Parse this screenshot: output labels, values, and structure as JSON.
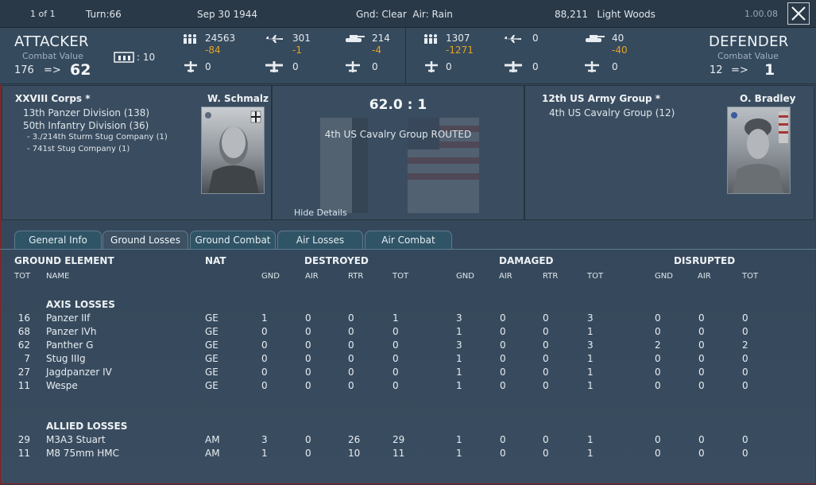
{
  "topbar": {
    "page": "1 of 1",
    "turn": "Turn:66",
    "date": "Sep 30 1944",
    "weather": "Gnd: Clear  Air: Rain",
    "location": "88,211   Light Woods",
    "version": "1.00.08"
  },
  "attacker": {
    "title": "ATTACKER",
    "cv_label": "Combat Value",
    "cv_from": "176",
    "cv_arrow": "=>",
    "cv_to": "62",
    "fort_value": ": 10",
    "men": "24563",
    "men_loss": "-84",
    "air": "301",
    "air_loss": "-1",
    "tanks": "214",
    "tanks_loss": "-4",
    "row2_a": "0",
    "row2_b": "0",
    "row2_c": "0"
  },
  "defender": {
    "title": "DEFENDER",
    "cv_label": "Combat Value",
    "cv_from": "12",
    "cv_arrow": "=>",
    "cv_to": "1",
    "men": "1307",
    "men_loss": "-1271",
    "air": "0",
    "tanks": "40",
    "tanks_loss": "-40",
    "row2_a": "0",
    "row2_b": "0",
    "row2_c": "0"
  },
  "attacker_panel": {
    "corps": "XXVIII Corps *",
    "leader": "W. Schmalz",
    "units": [
      "13th Panzer Division (138)",
      "50th Infantry Division (36)"
    ],
    "subunits": [
      "- 3./214th Sturm Stug Company (1)",
      "- 741st Stug Company (1)"
    ]
  },
  "center_panel": {
    "odds": "62.0 : 1",
    "result": "4th US Cavalry Group ROUTED",
    "hide_details": "Hide Details"
  },
  "defender_panel": {
    "corps": "12th US Army Group *",
    "leader": "O. Bradley",
    "units": [
      "4th US Cavalry Group (12)"
    ]
  },
  "tabs": [
    "General Info",
    "Ground Losses",
    "Ground Combat",
    "Air Losses",
    "Air Combat"
  ],
  "active_tab": "Ground Losses",
  "table": {
    "headers": {
      "element": "GROUND ELEMENT",
      "nat": "NAT",
      "destroyed": "DESTROYED",
      "damaged": "DAMAGED",
      "disrupted": "DISRUPTED"
    },
    "subheaders": {
      "tot": "TOT",
      "name": "NAME",
      "d_gnd": "GND",
      "d_air": "AIR",
      "d_rtr": "RTR",
      "d_tot": "TOT",
      "m_gnd": "GND",
      "m_air": "AIR",
      "m_rtr": "RTR",
      "m_tot": "TOT",
      "r_gnd": "GND",
      "r_air": "AIR",
      "r_tot": "TOT"
    },
    "axis_title": "AXIS LOSSES",
    "axis_rows": [
      [
        "16",
        "Panzer IIf",
        "GE",
        "1",
        "0",
        "0",
        "1",
        "3",
        "0",
        "0",
        "3",
        "0",
        "0",
        "0"
      ],
      [
        "68",
        "Panzer IVh",
        "GE",
        "0",
        "0",
        "0",
        "0",
        "1",
        "0",
        "0",
        "1",
        "0",
        "0",
        "0"
      ],
      [
        "62",
        "Panther G",
        "GE",
        "0",
        "0",
        "0",
        "0",
        "3",
        "0",
        "0",
        "3",
        "2",
        "0",
        "2"
      ],
      [
        "7",
        "Stug IIIg",
        "GE",
        "0",
        "0",
        "0",
        "0",
        "1",
        "0",
        "0",
        "1",
        "0",
        "0",
        "0"
      ],
      [
        "27",
        "Jagdpanzer IV",
        "GE",
        "0",
        "0",
        "0",
        "0",
        "1",
        "0",
        "0",
        "1",
        "0",
        "0",
        "0"
      ],
      [
        "11",
        "Wespe",
        "GE",
        "0",
        "0",
        "0",
        "0",
        "1",
        "0",
        "0",
        "1",
        "0",
        "0",
        "0"
      ]
    ],
    "allied_title": "ALLIED LOSSES",
    "allied_rows": [
      [
        "29",
        "M3A3 Stuart",
        "AM",
        "3",
        "0",
        "26",
        "29",
        "1",
        "0",
        "0",
        "1",
        "0",
        "0",
        "0"
      ],
      [
        "11",
        "M8 75mm HMC",
        "AM",
        "1",
        "0",
        "10",
        "11",
        "1",
        "0",
        "0",
        "1",
        "0",
        "0",
        "0"
      ]
    ]
  },
  "colors": {
    "loss": "#e3a321",
    "background": "#34475a",
    "tab_active": "#3d5163",
    "tab_inactive": "#2f5466",
    "frame_border": "#8a1e1e"
  }
}
